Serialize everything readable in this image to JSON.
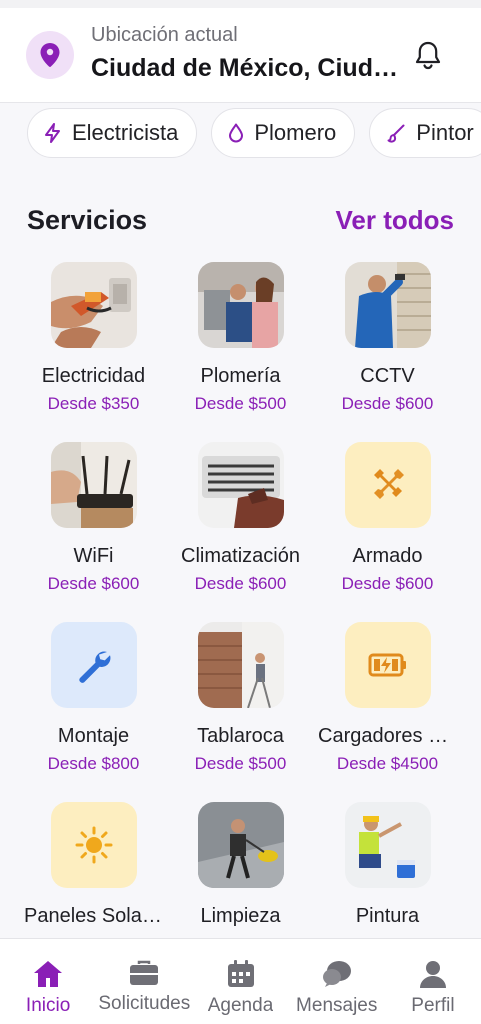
{
  "header": {
    "location_label": "Ubicación actual",
    "location_value": "Ciudad de México, Ciudad de México",
    "icons": {
      "location": "location-pin-icon",
      "notifications": "bell-icon"
    }
  },
  "categories": [
    {
      "label": "Electricista",
      "icon": "bolt-icon"
    },
    {
      "label": "Plomero",
      "icon": "droplet-icon"
    },
    {
      "label": "Pintor",
      "icon": "brush-icon"
    }
  ],
  "services_section": {
    "title": "Servicios",
    "see_all": "Ver todos"
  },
  "services": [
    {
      "name": "Electricidad",
      "price": "Desde $350"
    },
    {
      "name": "Plomería",
      "price": "Desde $500"
    },
    {
      "name": "CCTV",
      "price": "Desde $600"
    },
    {
      "name": "WiFi",
      "price": "Desde $600"
    },
    {
      "name": "Climatización",
      "price": "Desde $600"
    },
    {
      "name": "Armado",
      "price": "Desde $600"
    },
    {
      "name": "Montaje",
      "price": "Desde $800"
    },
    {
      "name": "Tablaroca",
      "price": "Desde $500"
    },
    {
      "name": "Cargadores eléctricos",
      "price": "Desde $4500"
    },
    {
      "name": "Paneles Solares",
      "price": ""
    },
    {
      "name": "Limpieza",
      "price": ""
    },
    {
      "name": "Pintura",
      "price": ""
    }
  ],
  "bottom_nav": [
    {
      "label": "Inicio",
      "icon": "home-icon",
      "active": true
    },
    {
      "label": "Solicitudes",
      "icon": "briefcase-icon",
      "active": false
    },
    {
      "label": "Agenda",
      "icon": "calendar-icon",
      "active": false
    },
    {
      "label": "Mensajes",
      "icon": "chat-icon",
      "active": false
    },
    {
      "label": "Perfil",
      "icon": "user-icon",
      "active": false
    }
  ],
  "colors": {
    "accent": "#8a1fb6",
    "tool_tile": "#fdeec0",
    "tool_icon": "#e08a1c",
    "wrench_tile": "#dde9fb",
    "wrench_icon": "#2f6fd6"
  }
}
